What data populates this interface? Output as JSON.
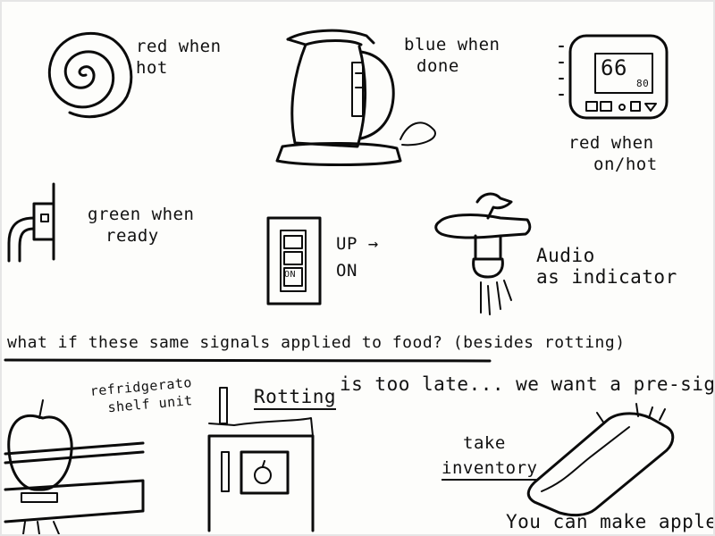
{
  "notes": {
    "spiral": [
      "red when",
      "hot"
    ],
    "kettle": [
      "blue when",
      "done"
    ],
    "thermostat": [
      "red when",
      "on/hot"
    ],
    "thermostat_display": "66",
    "thermostat_small": "80",
    "outlet": [
      "green when",
      "ready"
    ],
    "switch": [
      "UP →",
      "ON"
    ],
    "switch_label": "ON",
    "faucet": [
      "Audio",
      "as indicator"
    ],
    "question": "what if these same signals applied to food? (besides rotting)",
    "rotting": "Rotting",
    "too_late": "is too late... we want a pre-signal",
    "fridge_shelf": [
      "refridgerato",
      "shelf unit"
    ],
    "take": "take",
    "inventory": "inventory",
    "apples": "You can make apples"
  },
  "colors": {
    "ink": "#0b0b0b",
    "paper": "#fdfdfb"
  }
}
